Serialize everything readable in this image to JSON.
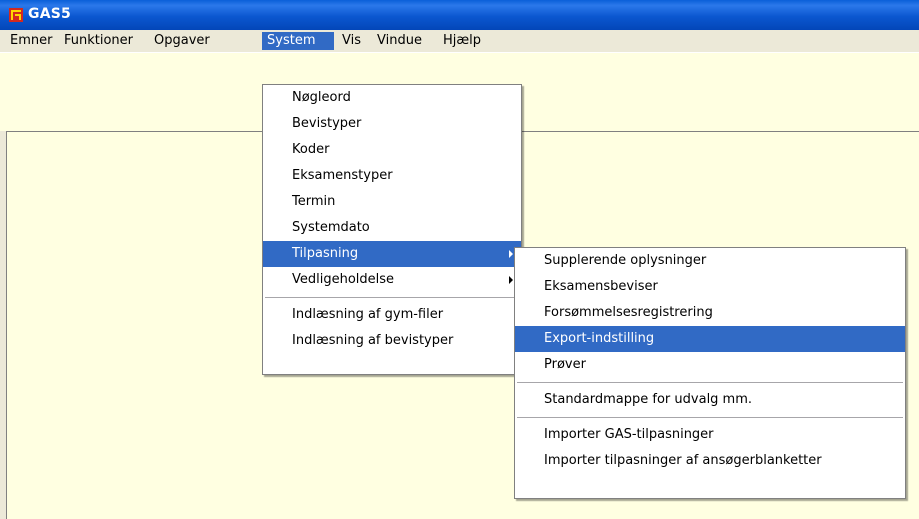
{
  "window": {
    "title": "GAS5",
    "icon": "gas5-app-icon"
  },
  "menubar": {
    "items": [
      "Emner",
      "Funktioner",
      "Opgaver",
      "System",
      "Vis",
      "Vindue",
      "Hjælp"
    ],
    "active": "System"
  },
  "system_menu": {
    "items": [
      {
        "label": "Nøgleord"
      },
      {
        "label": "Bevistyper"
      },
      {
        "label": "Koder"
      },
      {
        "label": "Eksamenstyper"
      },
      {
        "label": "Termin"
      },
      {
        "label": "Systemdato"
      },
      {
        "label": "Tilpasning",
        "submenu": true,
        "highlighted": true
      },
      {
        "label": "Vedligeholdelse",
        "submenu": true
      },
      {
        "label": "Indlæsning af gym-filer"
      },
      {
        "label": "Indlæsning af bevistyper"
      }
    ]
  },
  "tilpasning_submenu": {
    "items": [
      {
        "label": "Supplerende oplysninger"
      },
      {
        "label": "Eksamensbeviser"
      },
      {
        "label": "Forsømmelsesregistrering"
      },
      {
        "label": "Export-indstilling",
        "highlighted": true
      },
      {
        "label": "Prøver"
      },
      {
        "label": "Standardmappe for udvalg mm."
      },
      {
        "label": "Importer GAS-tilpasninger"
      },
      {
        "label": "Importer tilpasninger af ansøgerblanketter"
      }
    ]
  },
  "colors": {
    "titlebar": "#0b57d0",
    "menu_highlight": "#316ac5",
    "background": "#ffffe1",
    "chrome": "#ece9d8"
  }
}
